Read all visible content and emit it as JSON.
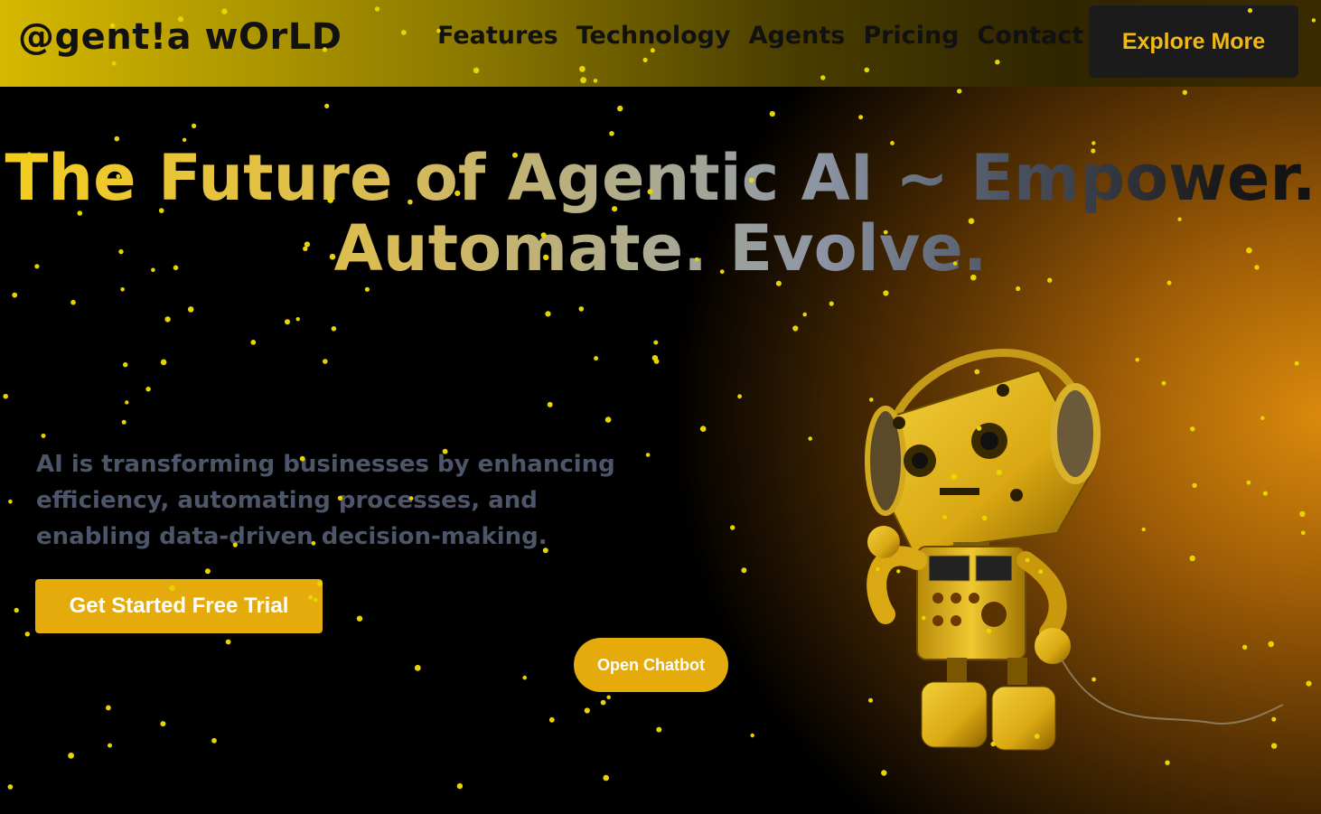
{
  "nav": {
    "logo": "@gent!a wOrLD",
    "items": [
      "Features",
      "Technology",
      "Agents",
      "Pricing",
      "Contact"
    ],
    "cta": "Explore More"
  },
  "hero": {
    "title_line1": "The Future of Agentic AI ~ Empower.",
    "title_line2": "Automate. Evolve.",
    "description": "AI is transforming businesses by enhancing efficiency, automating processes, and enabling data-driven decision-making.",
    "primary_button": "Get Started Free Trial",
    "chatbot_button": "Open Chatbot"
  },
  "colors": {
    "accent": "#e5ab0d",
    "nav_start": "#d6b800",
    "dot": "#e8d400"
  },
  "icons": {
    "robot": "robot-with-headphones-illustration"
  }
}
